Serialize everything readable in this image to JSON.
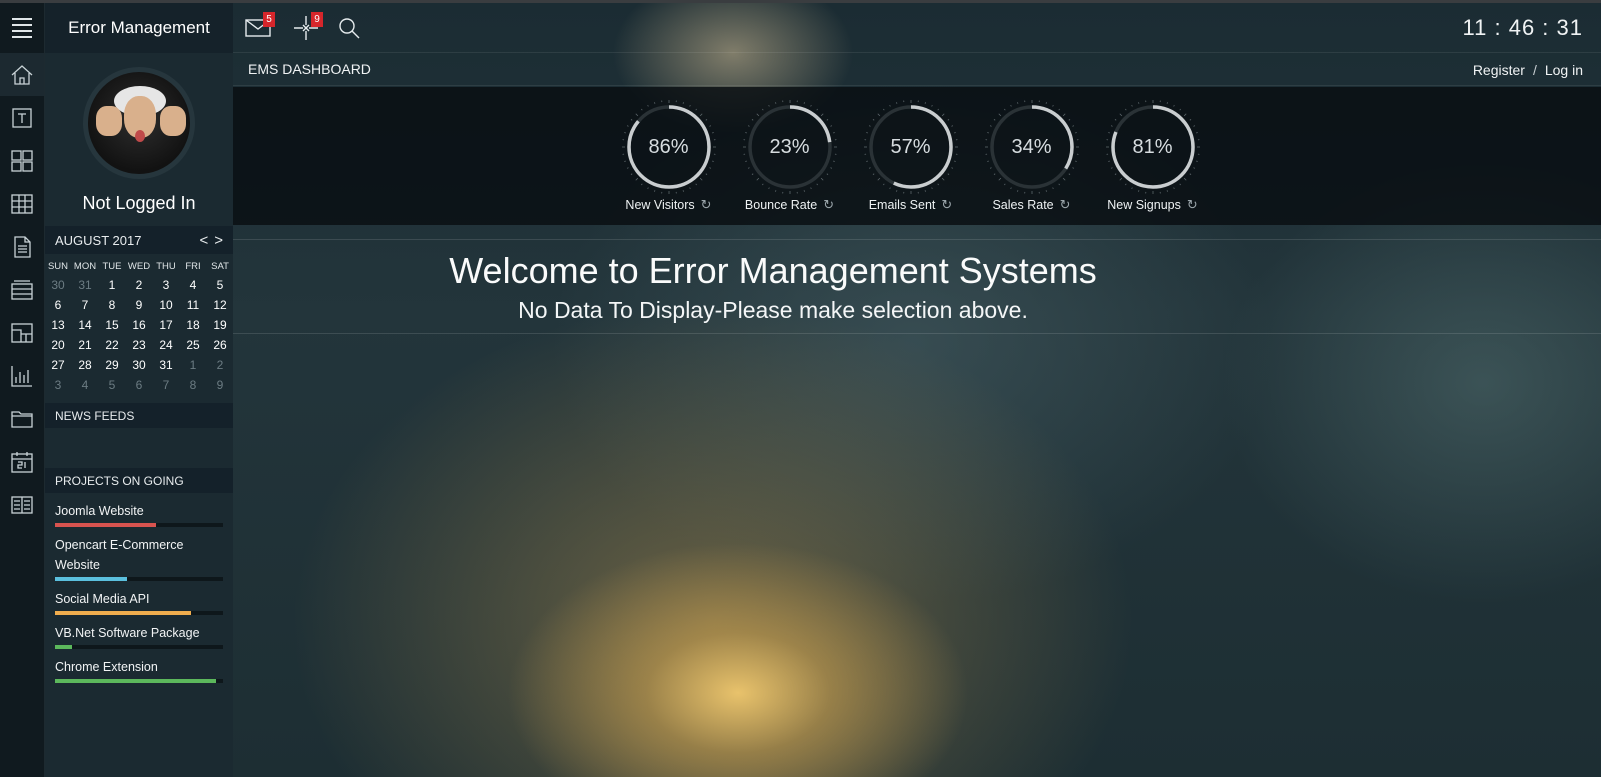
{
  "app": {
    "title": "Error Management"
  },
  "rail": {
    "items": [
      {
        "icon": "home-icon"
      },
      {
        "icon": "text-icon"
      },
      {
        "icon": "grid-icon"
      },
      {
        "icon": "table-icon"
      },
      {
        "icon": "document-icon"
      },
      {
        "icon": "list-icon"
      },
      {
        "icon": "layout-icon"
      },
      {
        "icon": "bar-chart-icon"
      },
      {
        "icon": "folder-icon"
      },
      {
        "icon": "calendar-icon"
      },
      {
        "icon": "columns-icon"
      }
    ]
  },
  "profile": {
    "status": "Not Logged In"
  },
  "calendar": {
    "month": "AUGUST 2017",
    "prev": "<",
    "next": ">",
    "days_of_week": [
      "SUN",
      "MON",
      "TUE",
      "WED",
      "THU",
      "FRI",
      "SAT"
    ],
    "weeks": [
      [
        [
          "30",
          1
        ],
        [
          "31",
          1
        ],
        [
          "1",
          0
        ],
        [
          "2",
          0
        ],
        [
          "3",
          0
        ],
        [
          "4",
          0
        ],
        [
          "5",
          0
        ]
      ],
      [
        [
          "6",
          0
        ],
        [
          "7",
          0
        ],
        [
          "8",
          0
        ],
        [
          "9",
          0
        ],
        [
          "10",
          0
        ],
        [
          "11",
          0
        ],
        [
          "12",
          0
        ]
      ],
      [
        [
          "13",
          0
        ],
        [
          "14",
          0
        ],
        [
          "15",
          0
        ],
        [
          "16",
          0
        ],
        [
          "17",
          0
        ],
        [
          "18",
          0
        ],
        [
          "19",
          0
        ]
      ],
      [
        [
          "20",
          0
        ],
        [
          "21",
          0
        ],
        [
          "22",
          0
        ],
        [
          "23",
          0
        ],
        [
          "24",
          0
        ],
        [
          "25",
          0
        ],
        [
          "26",
          0
        ]
      ],
      [
        [
          "27",
          0
        ],
        [
          "28",
          0
        ],
        [
          "29",
          0
        ],
        [
          "30",
          0
        ],
        [
          "31",
          0
        ],
        [
          "1",
          1
        ],
        [
          "2",
          1
        ]
      ],
      [
        [
          "3",
          1
        ],
        [
          "4",
          1
        ],
        [
          "5",
          1
        ],
        [
          "6",
          1
        ],
        [
          "7",
          1
        ],
        [
          "8",
          1
        ],
        [
          "9",
          1
        ]
      ]
    ]
  },
  "news": {
    "heading": "NEWS FEEDS"
  },
  "projects": {
    "heading": "PROJECTS ON GOING",
    "items": [
      {
        "name": "Joomla Website",
        "progress": 0.6,
        "color": "#d9534f"
      },
      {
        "name": "Opencart E-Commerce Website",
        "progress": 0.43,
        "color": "#5bc0de"
      },
      {
        "name": "Social Media API",
        "progress": 0.81,
        "color": "#f0ad4e"
      },
      {
        "name": "VB.Net Software Package",
        "progress": 0.1,
        "color": "#5cb85c"
      },
      {
        "name": "Chrome Extension",
        "progress": 0.96,
        "color": "#5cb85c"
      }
    ]
  },
  "topbar": {
    "mail_badge": "5",
    "alerts_badge": "9",
    "clock": "11 : 46 : 31"
  },
  "subbar": {
    "breadcrumb": "EMS DASHBOARD",
    "register": "Register",
    "separator": "/",
    "login": "Log in"
  },
  "gauges": [
    {
      "value": 86,
      "display": "86%",
      "label": "New Visitors"
    },
    {
      "value": 23,
      "display": "23%",
      "label": "Bounce Rate"
    },
    {
      "value": 57,
      "display": "57%",
      "label": "Emails Sent"
    },
    {
      "value": 34,
      "display": "34%",
      "label": "Sales Rate"
    },
    {
      "value": 81,
      "display": "81%",
      "label": "New Signups"
    }
  ],
  "welcome": {
    "title": "Welcome to Error Management Systems",
    "subtitle": "No Data To Display-Please make selection above."
  }
}
